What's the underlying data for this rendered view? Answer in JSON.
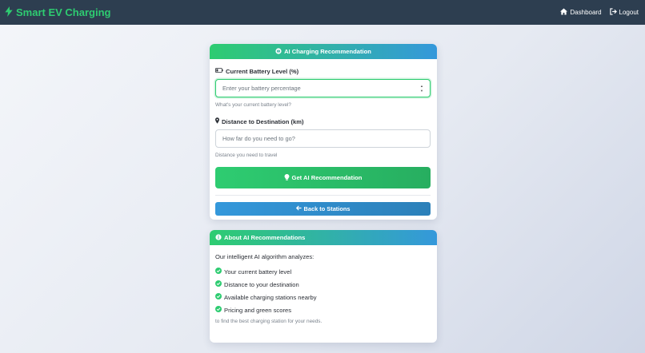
{
  "app": {
    "title": "Smart EV Charging",
    "icon": "bolt-icon"
  },
  "nav": {
    "dashboard": {
      "label": "Dashboard",
      "icon": "home-icon"
    },
    "logout": {
      "label": "Logout",
      "icon": "sign-out-icon"
    }
  },
  "recommendation": {
    "header": "AI Charging Recommendation",
    "battery": {
      "label": "Current Battery Level (%)",
      "placeholder": "Enter your battery percentage",
      "value": "",
      "help": "What's your current battery level?"
    },
    "distance": {
      "label": "Distance to Destination (km)",
      "placeholder": "How far do you need to go?",
      "value": "",
      "help": "Distance you need to travel"
    },
    "submit_label": "Get AI Recommendation",
    "back_label": "Back to Stations"
  },
  "about": {
    "header": "About AI Recommendations",
    "intro": "Our intelligent AI algorithm analyzes:",
    "items": [
      "Your current battery level",
      "Distance to your destination",
      "Available charging stations nearby",
      "Pricing and green scores"
    ],
    "footer": "to find the best charging station for your needs."
  },
  "colors": {
    "navbar": "#2d3e50",
    "brand": "#2ecc71",
    "primary_green": "#2ecc71",
    "primary_blue": "#3498db",
    "muted_text": "#7a828c"
  }
}
